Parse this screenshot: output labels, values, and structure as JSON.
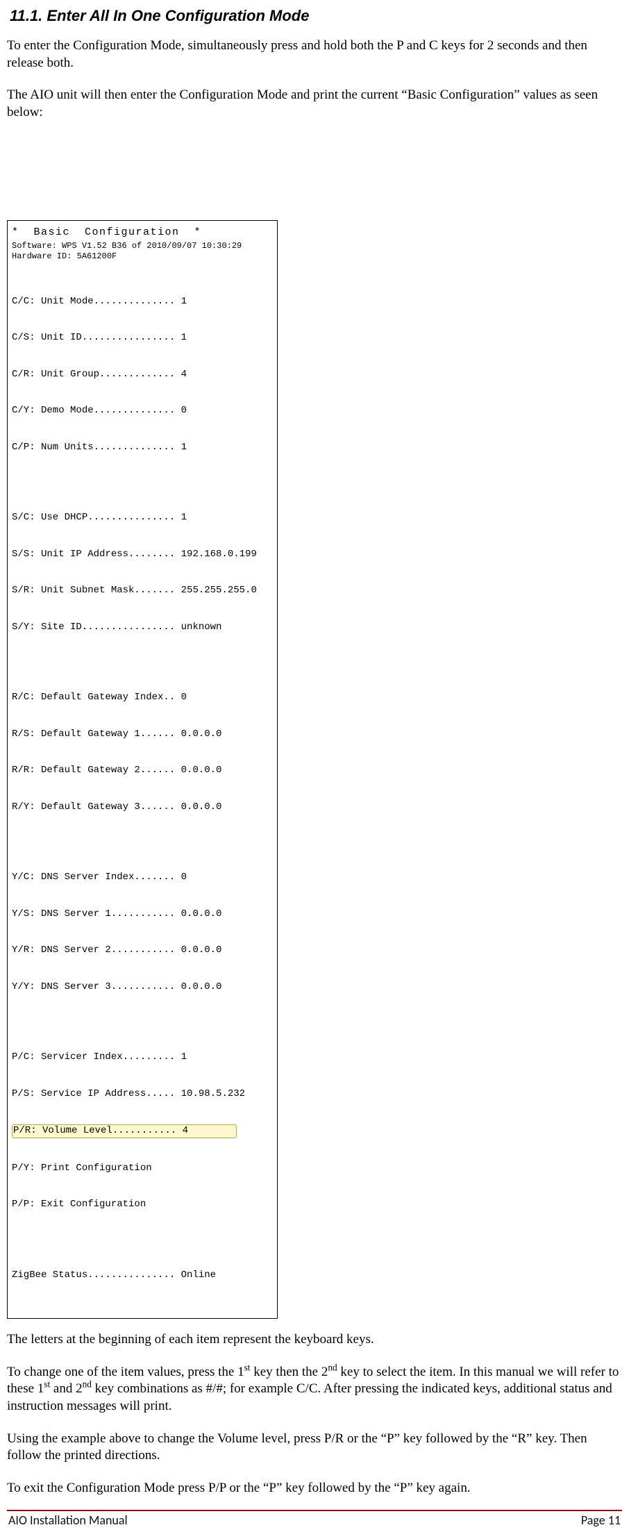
{
  "heading": "11.1. Enter All In One Configuration Mode",
  "para1": "To enter the Configuration Mode, simultaneously press and hold both the P and C keys for 2 seconds and then release both.",
  "para2": "The AIO unit will then enter the Configuration Mode and print the current “Basic Configuration” values as seen below:",
  "printout": {
    "title": "*  Basic  Configuration  *",
    "software": "Software: WPS V1.52 B36 of 2010/09/07 10:30:29",
    "hardware": "Hardware ID: 5A61200F",
    "group1": [
      "C/C: Unit Mode.............. 1",
      "C/S: Unit ID................ 1",
      "C/R: Unit Group............. 4",
      "C/Y: Demo Mode.............. 0",
      "C/P: Num Units.............. 1"
    ],
    "group2": [
      "S/C: Use DHCP............... 1",
      "S/S: Unit IP Address........ 192.168.0.199",
      "S/R: Unit Subnet Mask....... 255.255.255.0",
      "S/Y: Site ID................ unknown"
    ],
    "group3": [
      "R/C: Default Gateway Index.. 0",
      "R/S: Default Gateway 1...... 0.0.0.0",
      "R/R: Default Gateway 2...... 0.0.0.0",
      "R/Y: Default Gateway 3...... 0.0.0.0"
    ],
    "group4": [
      "Y/C: DNS Server Index....... 0",
      "Y/S: DNS Server 1........... 0.0.0.0",
      "Y/R: DNS Server 2........... 0.0.0.0",
      "Y/Y: DNS Server 3........... 0.0.0.0"
    ],
    "group5_pre": [
      "P/C: Servicer Index......... 1",
      "P/S: Service IP Address..... 10.98.5.232"
    ],
    "group5_highlight": "P/R: Volume Level........... 4",
    "group5_post": [
      "P/Y: Print Configuration",
      "P/P: Exit Configuration"
    ],
    "zigbee": "ZigBee Status............... Online"
  },
  "para3": "The letters at the beginning of each item represent the keyboard keys.",
  "para4a": "To change one of the item values, press the 1",
  "para4b": " key then the 2",
  "para4c": " key to select the item.  In this manual we will refer to these 1",
  "para4d": " and 2",
  "para4e": " key combinations as #/#; for example C/C. After pressing the indicated keys, additional status and instruction messages will print.",
  "sup_st": "st",
  "sup_nd": "nd",
  "para5": "Using the example above to change the Volume level, press P/R or the “P” key followed by the “R” key. Then follow the printed directions.",
  "para6": "To exit the Configuration Mode press P/P or the “P” key followed by the “P” key again.",
  "footer_left": "AIO Installation Manual",
  "footer_right": "Page 11"
}
